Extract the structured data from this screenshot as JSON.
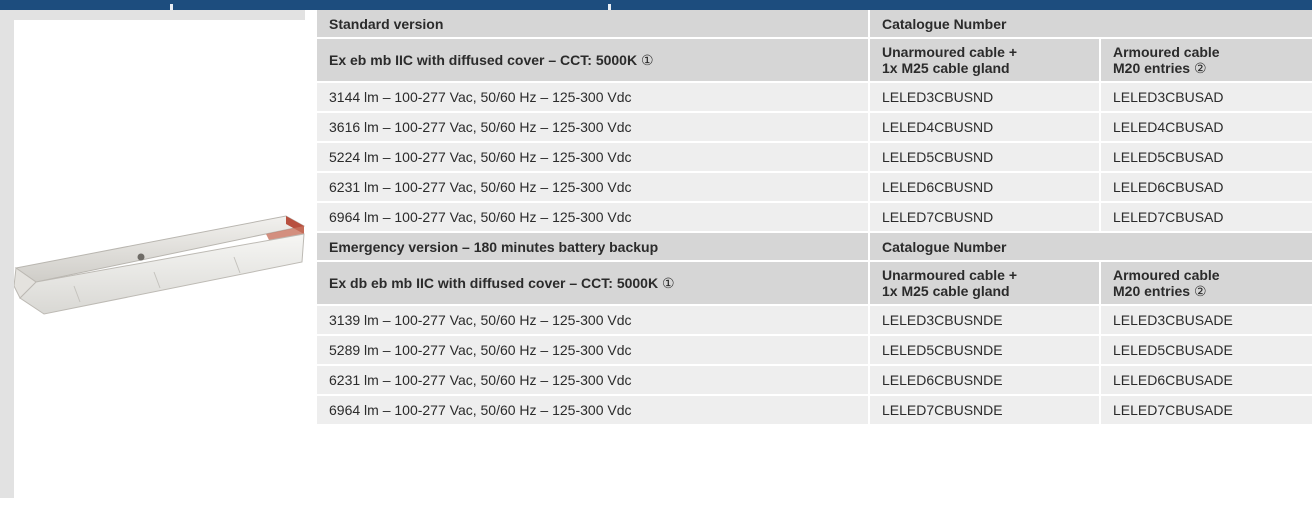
{
  "colors": {
    "header_bar": "#1d4d7e",
    "heading_row": "#d6d6d6",
    "data_row": "#eeeeee",
    "image_panel": "#e2e2e2"
  },
  "image": {
    "icon": "explosion-proof-led-luminaire-photo"
  },
  "sections": [
    {
      "title": "Standard version",
      "catalogue_heading": "Catalogue Number",
      "subtitle": "Ex eb mb IIC with diffused cover – CCT: 5000K",
      "subtitle_note": "①",
      "col1": {
        "line1": "Unarmoured cable +",
        "line2": "1x M25 cable gland"
      },
      "col2": {
        "line1": "Armoured cable",
        "line2": "M20 entries",
        "note": "②"
      },
      "rows": [
        {
          "desc": "3144 lm – 100-277 Vac, 50/60 Hz – 125-300 Vdc",
          "unarmoured": "LELED3CBUSND",
          "armoured": "LELED3CBUSAD"
        },
        {
          "desc": "3616 lm – 100-277 Vac, 50/60 Hz – 125-300 Vdc",
          "unarmoured": "LELED4CBUSND",
          "armoured": "LELED4CBUSAD"
        },
        {
          "desc": "5224 lm – 100-277 Vac, 50/60 Hz – 125-300 Vdc",
          "unarmoured": "LELED5CBUSND",
          "armoured": "LELED5CBUSAD"
        },
        {
          "desc": "6231 lm – 100-277 Vac, 50/60 Hz – 125-300 Vdc",
          "unarmoured": "LELED6CBUSND",
          "armoured": "LELED6CBUSAD"
        },
        {
          "desc": "6964 lm – 100-277 Vac, 50/60 Hz – 125-300 Vdc",
          "unarmoured": "LELED7CBUSND",
          "armoured": "LELED7CBUSAD"
        }
      ]
    },
    {
      "title": "Emergency version – 180 minutes battery backup",
      "catalogue_heading": "Catalogue Number",
      "subtitle": "Ex db eb mb IIC with diffused cover – CCT: 5000K",
      "subtitle_note": "①",
      "col1": {
        "line1": "Unarmoured cable +",
        "line2": "1x M25 cable gland"
      },
      "col2": {
        "line1": "Armoured cable",
        "line2": "M20 entries",
        "note": "②"
      },
      "rows": [
        {
          "desc": "3139 lm – 100-277 Vac, 50/60 Hz – 125-300 Vdc",
          "unarmoured": "LELED3CBUSNDE",
          "armoured": "LELED3CBUSADE"
        },
        {
          "desc": "5289 lm – 100-277 Vac, 50/60 Hz – 125-300 Vdc",
          "unarmoured": "LELED5CBUSNDE",
          "armoured": "LELED5CBUSADE"
        },
        {
          "desc": "6231 lm – 100-277 Vac, 50/60 Hz – 125-300 Vdc",
          "unarmoured": "LELED6CBUSNDE",
          "armoured": "LELED6CBUSADE"
        },
        {
          "desc": "6964 lm – 100-277 Vac, 50/60 Hz – 125-300 Vdc",
          "unarmoured": "LELED7CBUSNDE",
          "armoured": "LELED7CBUSADE"
        }
      ]
    }
  ]
}
